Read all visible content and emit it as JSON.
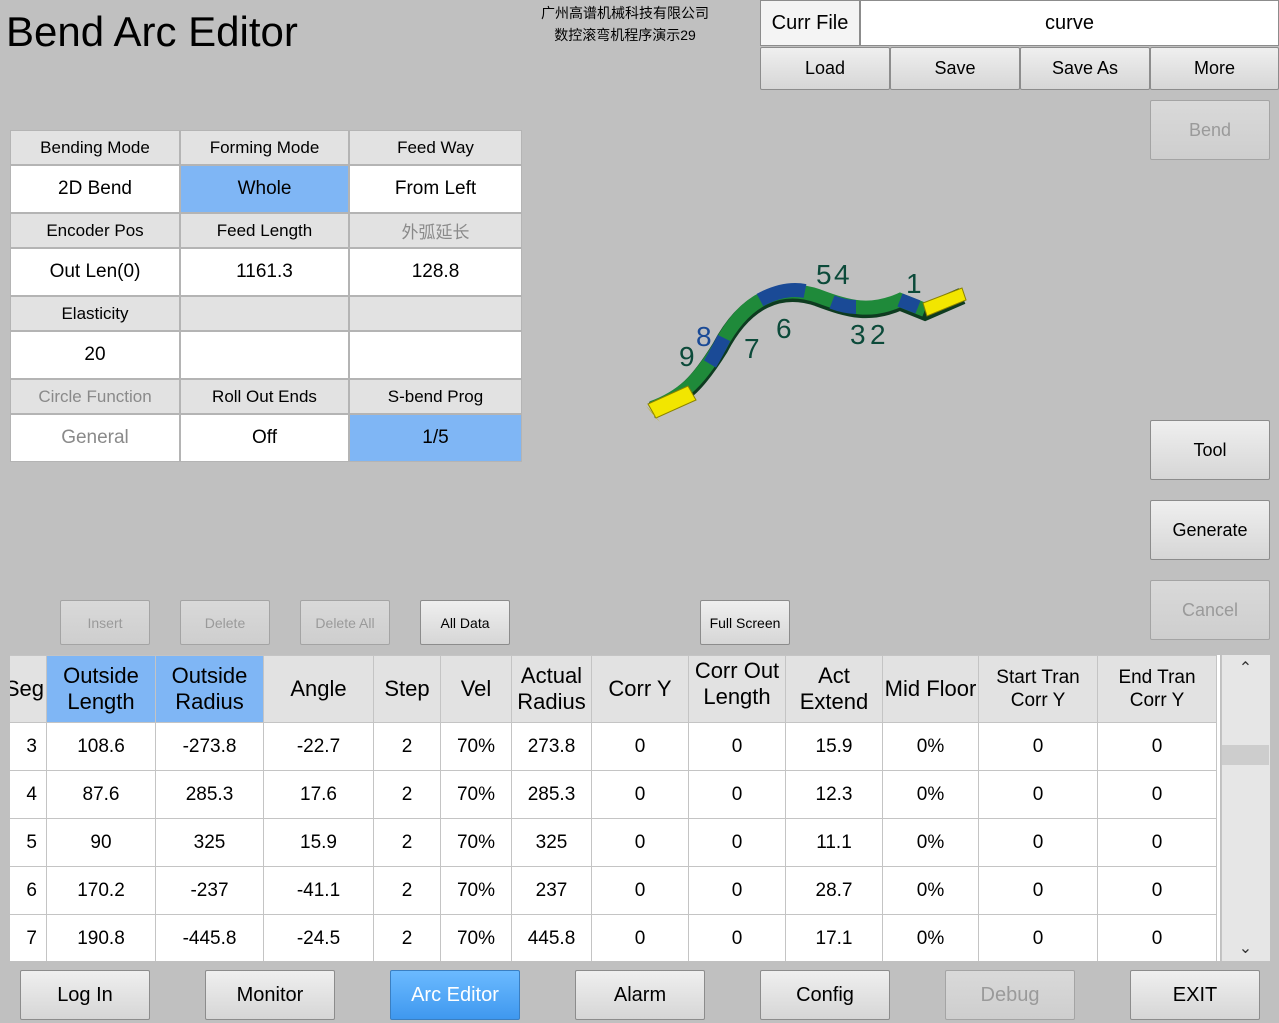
{
  "app": {
    "title": "Bend Arc Editor",
    "company_line1": "广州高谱机械科技有限公司",
    "company_line2": "数控滚弯机程序演示29"
  },
  "file": {
    "label": "Curr File",
    "value": "curve"
  },
  "file_buttons": {
    "load": "Load",
    "save": "Save",
    "save_as": "Save As",
    "more": "More"
  },
  "side_buttons": {
    "bend": "Bend",
    "tool": "Tool",
    "generate": "Generate",
    "cancel": "Cancel"
  },
  "params": {
    "bending_mode": {
      "label": "Bending Mode",
      "value": "2D Bend"
    },
    "forming_mode": {
      "label": "Forming Mode",
      "value": "Whole"
    },
    "feed_way": {
      "label": "Feed Way",
      "value": "From Left"
    },
    "encoder_pos": {
      "label": "Encoder Pos",
      "value": "Out Len(0)"
    },
    "feed_length": {
      "label": "Feed Length",
      "value": "1161.3"
    },
    "outer_extend": {
      "label": "外弧延长",
      "value": "128.8"
    },
    "elasticity": {
      "label": "Elasticity",
      "value": "20"
    },
    "circle_function": {
      "label": "Circle Function",
      "value": "General"
    },
    "roll_out_ends": {
      "label": "Roll Out Ends",
      "value": "Off"
    },
    "sbend_prog": {
      "label": "S-bend Prog",
      "value": "1/5"
    }
  },
  "preview": {
    "labels": [
      "1",
      "2",
      "3",
      "4",
      "5",
      "6",
      "7",
      "8",
      "9"
    ],
    "colors": {
      "end_cap": "#f2e600",
      "green": "#1f8a3a",
      "blue": "#1a4a96",
      "label": "#0c4a3a"
    }
  },
  "table_buttons": {
    "insert": "Insert",
    "delete": "Delete",
    "delete_all": "Delete All",
    "all_data": "All Data",
    "full_screen": "Full Screen"
  },
  "table": {
    "headers": {
      "seg": "Seg",
      "outside_length": "Outside Length",
      "outside_radius": "Outside Radius",
      "angle": "Angle",
      "step": "Step",
      "vel": "Vel",
      "actual_radius": "Actual Radius",
      "corr_y": "Corr Y",
      "corr_out_len": "Corr Out Length",
      "act_extend": "Act Extend",
      "mid_floor": "Mid Floor",
      "start_tran": "Start Tran Corr Y",
      "end_tran": "End Tran Corr Y"
    },
    "rows": [
      [
        "3",
        "108.6",
        "-273.8",
        "-22.7",
        "2",
        "70%",
        "273.8",
        "0",
        "0",
        "15.9",
        "0%",
        "0",
        "0"
      ],
      [
        "4",
        "87.6",
        "285.3",
        "17.6",
        "2",
        "70%",
        "285.3",
        "0",
        "0",
        "12.3",
        "0%",
        "0",
        "0"
      ],
      [
        "5",
        "90",
        "325",
        "15.9",
        "2",
        "70%",
        "325",
        "0",
        "0",
        "11.1",
        "0%",
        "0",
        "0"
      ],
      [
        "6",
        "170.2",
        "-237",
        "-41.1",
        "2",
        "70%",
        "237",
        "0",
        "0",
        "28.7",
        "0%",
        "0",
        "0"
      ],
      [
        "7",
        "190.8",
        "-445.8",
        "-24.5",
        "2",
        "70%",
        "445.8",
        "0",
        "0",
        "17.1",
        "0%",
        "0",
        "0"
      ]
    ]
  },
  "nav": {
    "log_in": "Log In",
    "monitor": "Monitor",
    "arc_editor": "Arc Editor",
    "alarm": "Alarm",
    "config": "Config",
    "debug": "Debug",
    "exit": "EXIT"
  }
}
